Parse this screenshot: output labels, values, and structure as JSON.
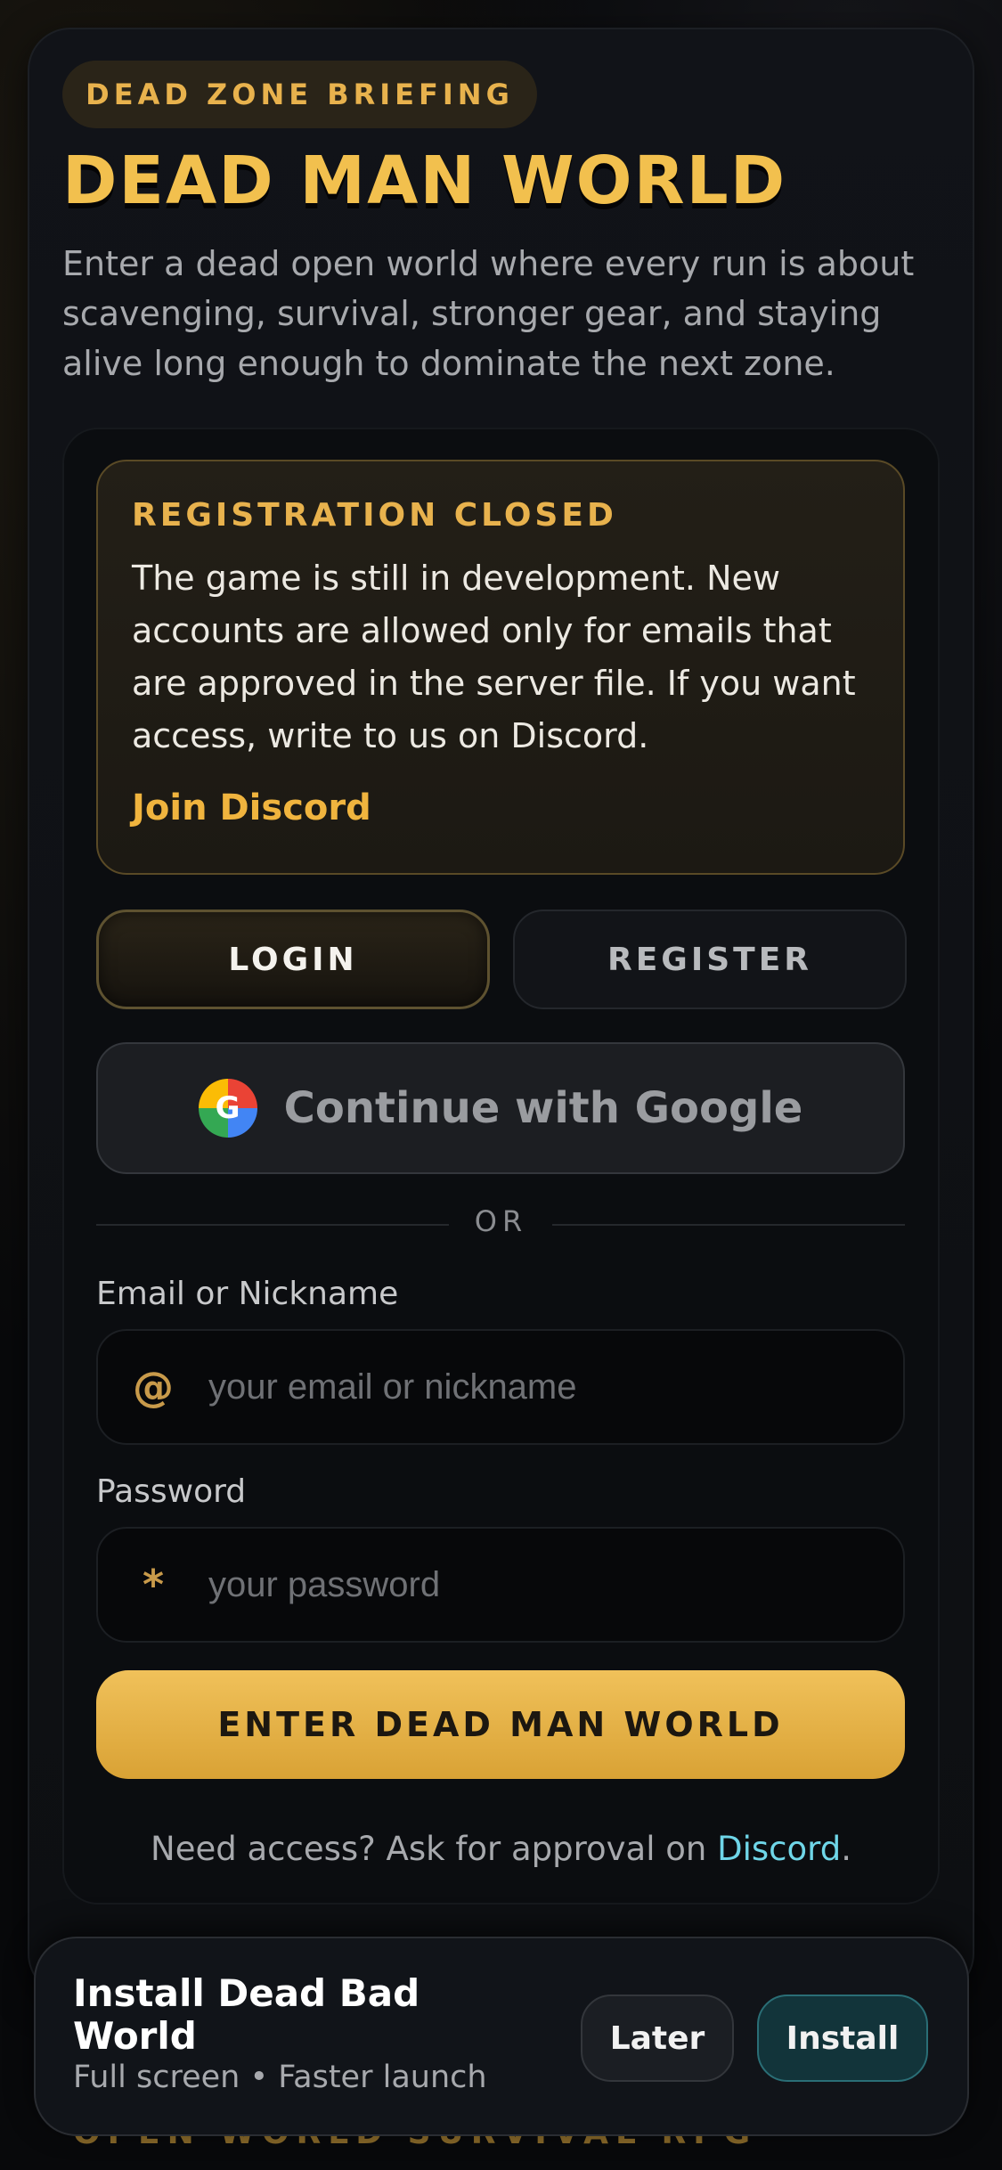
{
  "hero": {
    "badge": "DEAD ZONE BRIEFING",
    "title": "DEAD MAN WORLD",
    "subtitle": "Enter a dead open world where every run is about scavenging, survival, stronger gear, and staying alive long enough to dominate the next zone."
  },
  "notice": {
    "heading": "REGISTRATION CLOSED",
    "body": "The game is still in development. New accounts are allowed only for emails that are approved in the server file. If you want access, write to us on Discord.",
    "link": "Join Discord"
  },
  "tabs": {
    "login": "LOGIN",
    "register": "REGISTER"
  },
  "google": {
    "label": "Continue with Google",
    "logo_letter": "G"
  },
  "divider": {
    "text": "OR"
  },
  "form": {
    "email_label": "Email or Nickname",
    "email_icon": "@",
    "email_placeholder": "your email or nickname",
    "email_value": "",
    "password_label": "Password",
    "password_icon": "*",
    "password_placeholder": "your password",
    "password_value": "",
    "submit": "ENTER DEAD MAN WORLD"
  },
  "footer": {
    "need_prefix": "Need access? Ask for approval on ",
    "need_link": "Discord",
    "need_suffix": "."
  },
  "bottom_tag": "OPEN WORLD SURVIVAL RPG",
  "install_banner": {
    "title": "Install Dead Bad World",
    "subtitle": "Full screen • Faster launch",
    "later": "Later",
    "install": "Install"
  },
  "colors": {
    "accent_gold": "#f2c04e",
    "link_cyan": "#6fd6e8",
    "background": "#08090b"
  }
}
